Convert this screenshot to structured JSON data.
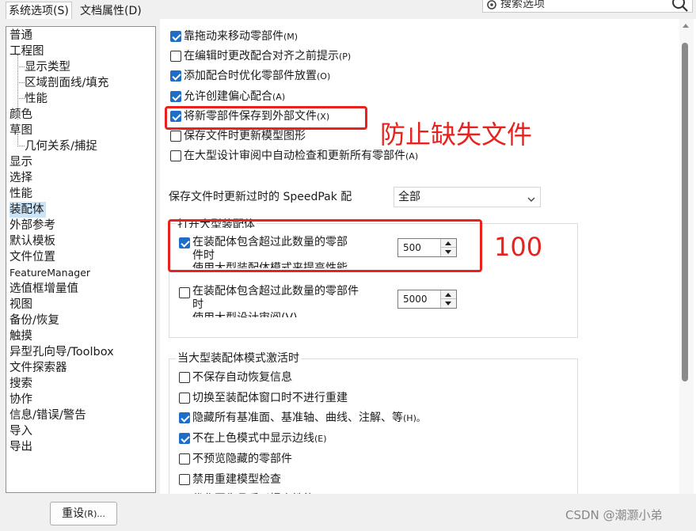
{
  "tabs": [
    {
      "label": "系统选项(S)",
      "active": true
    },
    {
      "label": "文档属性(D)",
      "active": false
    }
  ],
  "search": {
    "placeholder": "搜索选项",
    "icon": "search-icon",
    "gear_icon": "gear-icon"
  },
  "tree": {
    "items": [
      {
        "label": "普通",
        "level": 0
      },
      {
        "label": "工程图",
        "level": 0
      },
      {
        "label": "显示类型",
        "level": 1
      },
      {
        "label": "区域剖面线/填充",
        "level": 1
      },
      {
        "label": "性能",
        "level": 1
      },
      {
        "label": "颜色",
        "level": 0
      },
      {
        "label": "草图",
        "level": 0
      },
      {
        "label": "几何关系/捕捉",
        "level": 1
      },
      {
        "label": "显示",
        "level": 0
      },
      {
        "label": "选择",
        "level": 0
      },
      {
        "label": "性能",
        "level": 0
      },
      {
        "label": "装配体",
        "level": 0,
        "selected": true
      },
      {
        "label": "外部参考",
        "level": 0
      },
      {
        "label": "默认模板",
        "level": 0
      },
      {
        "label": "文件位置",
        "level": 0
      },
      {
        "label": "FeatureManager",
        "level": 0
      },
      {
        "label": "选值框增量值",
        "level": 0
      },
      {
        "label": "视图",
        "level": 0
      },
      {
        "label": "备份/恢复",
        "level": 0
      },
      {
        "label": "触摸",
        "level": 0
      },
      {
        "label": "异型孔向导/Toolbox",
        "level": 0
      },
      {
        "label": "文件探索器",
        "level": 0
      },
      {
        "label": "搜索",
        "level": 0
      },
      {
        "label": "协作",
        "level": 0
      },
      {
        "label": "信息/错误/警告",
        "level": 0
      },
      {
        "label": "导入",
        "level": 0
      },
      {
        "label": "导出",
        "level": 0
      }
    ]
  },
  "options": [
    {
      "text": "靠拖动来移动零部件",
      "key": "(M)",
      "checked": true
    },
    {
      "text": "在编辑时更改配合对齐之前提示",
      "key": "(P)",
      "checked": false
    },
    {
      "text": "添加配合时优化零部件放置",
      "key": "(O)",
      "checked": true
    },
    {
      "text": "允许创建偏心配合",
      "key": "(A)",
      "checked": true
    },
    {
      "text": "将新零部件保存到外部文件",
      "key": "(X)",
      "checked": true
    },
    {
      "text": "保存文件时更新模型图形",
      "key": "",
      "checked": false
    },
    {
      "text": "在大型设计审阅中自动检查和更新所有零部件",
      "key": "(A)",
      "checked": false
    }
  ],
  "speedpak": {
    "label": "保存文件时更新过时的 SpeedPak 配",
    "value": "全部"
  },
  "large_assembly": {
    "group_label": "打开大型装配体",
    "item1": {
      "line1": "在装配体包含超过此数量的零部",
      "line2": "件时",
      "line3": "使用大型装配体模式来提高性能",
      "checked": true,
      "value": "500"
    },
    "item2": {
      "line1": "在装配体包含超过此数量的零部件",
      "line2": "时",
      "line3": "使用大型设计审阅(V)",
      "checked": false,
      "value": "5000"
    }
  },
  "large_mode": {
    "group_label": "当大型装配体模式激活时",
    "items": [
      {
        "text": "不保存自动恢复信息",
        "key": "",
        "checked": false
      },
      {
        "text": "切换至装配体窗口时不进行重建",
        "key": "",
        "checked": false
      },
      {
        "text": "隐藏所有基准面、基准轴、曲线、注解、等",
        "key": "(H)。",
        "checked": true
      },
      {
        "text": "不在上色模式中显示边线",
        "key": "(E)",
        "checked": true
      },
      {
        "text": "不预览隐藏的零部件",
        "key": "",
        "checked": false
      },
      {
        "text": "禁用重建模型检查",
        "key": "",
        "checked": false
      },
      {
        "text": "优化图像品质以提高性能",
        "key": "",
        "checked": false
      }
    ]
  },
  "reset_button": {
    "label": "重设",
    "key": "(R)..."
  },
  "annotations": {
    "note1": "防止缺失文件",
    "note2": "100",
    "color": "#e8231f"
  },
  "watermark": "CSDN @潮灏小弟",
  "colors": {
    "checkbox": "#1e6ec8",
    "selected_tree": "#cce4f7"
  }
}
